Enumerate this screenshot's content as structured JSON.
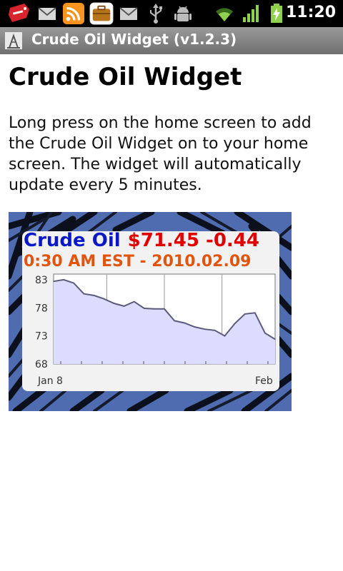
{
  "status_bar": {
    "icons": [
      "hot-deals-tag-icon",
      "gmail-icon",
      "rss-feed-icon",
      "briefcase-icon",
      "email-icon",
      "usb-icon",
      "android-debug-icon",
      "wifi-icon",
      "signal-bars-icon",
      "battery-charging-icon"
    ],
    "time": "11:20"
  },
  "title_bar": {
    "app_icon": "oil-derrick-icon",
    "title": "Crude Oil Widget (v1.2.3)"
  },
  "main": {
    "heading": "Crude Oil Widget",
    "description": "Long press on the home screen to add the Crude Oil Widget on to your home screen. The widget will automatically update every 5 minutes."
  },
  "widget": {
    "name": "Crude Oil",
    "price": "$71.45",
    "change": "-0.44",
    "timestamp": "0:30 AM EST - 2010.02.09",
    "colors": {
      "name": "#0a18c8",
      "price": "#e00000",
      "timestamp": "#e0550f",
      "fill": "#dcdcff",
      "line": "#5a5a7a"
    }
  },
  "chart_data": {
    "type": "area",
    "x_tick_labels": [
      "Jan 8",
      "Feb"
    ],
    "y_tick_labels": [
      "83",
      "78",
      "73",
      "68"
    ],
    "ylim": [
      68,
      84
    ],
    "values": [
      82.7,
      83.0,
      82.4,
      80.5,
      80.2,
      79.6,
      78.8,
      78.3,
      79.1,
      77.9,
      77.8,
      77.8,
      75.7,
      75.3,
      74.6,
      74.2,
      74.0,
      73.0,
      75.2,
      76.9,
      77.1,
      73.5,
      72.4
    ],
    "title": "",
    "xlabel": "",
    "ylabel": "",
    "grid": true
  }
}
